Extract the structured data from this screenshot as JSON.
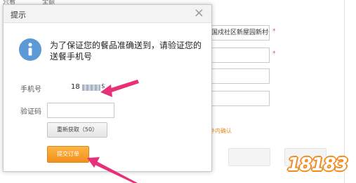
{
  "background": {
    "tabs": [
      "只看",
      "全额"
    ],
    "address_field_value": "国戍社区新屋园新村一",
    "confirm_text": "件内确认"
  },
  "modal": {
    "title": "提示",
    "close_glyph": "×",
    "message": "为了保证您的餐品准确送到，请验证您的送餐手机号",
    "phone_label": "手机号",
    "phone_value": "18",
    "phone_suffix": "$",
    "code_label": "验证码",
    "code_value": "",
    "resend_label": "重新获取（50）",
    "submit_label": "提交订单"
  },
  "watermark": {
    "text": "18183"
  },
  "colors": {
    "accent": "#f0901b",
    "arrow": "#e8307a",
    "info_icon": "#5b9ad6"
  }
}
